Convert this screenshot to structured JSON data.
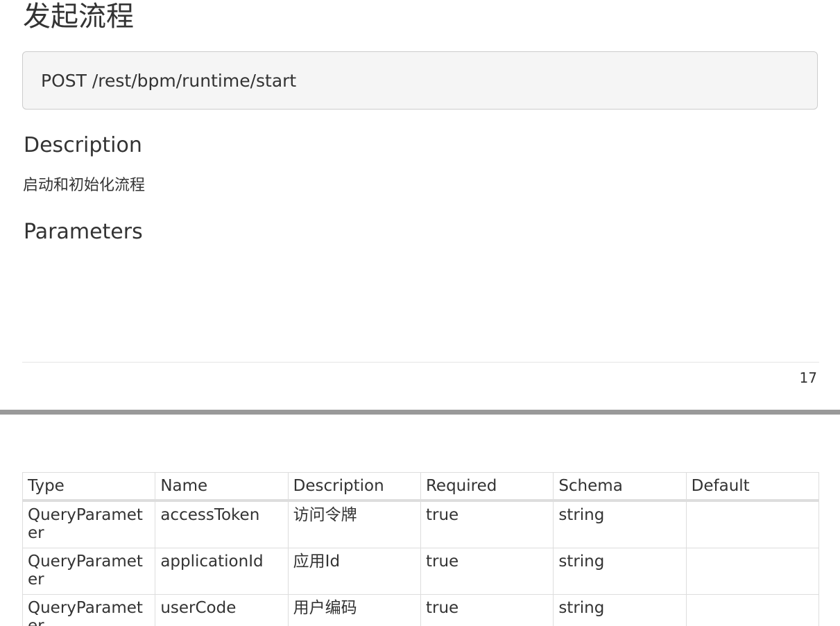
{
  "page": {
    "title": "发起流程",
    "endpoint": "POST /rest/bpm/runtime/start",
    "description_heading": "Description",
    "description_text": "启动和初始化流程",
    "parameters_heading": "Parameters",
    "page_number": "17"
  },
  "params_table": {
    "headers": [
      "Type",
      "Name",
      "Description",
      "Required",
      "Schema",
      "Default"
    ],
    "rows": [
      [
        "QueryParameter",
        "accessToken",
        "访问令牌",
        "true",
        "string",
        ""
      ],
      [
        "QueryParameter",
        "applicationId",
        "应用Id",
        "true",
        "string",
        ""
      ],
      [
        "QueryParameter",
        "userCode",
        "用户编码",
        "true",
        "string",
        ""
      ]
    ]
  }
}
